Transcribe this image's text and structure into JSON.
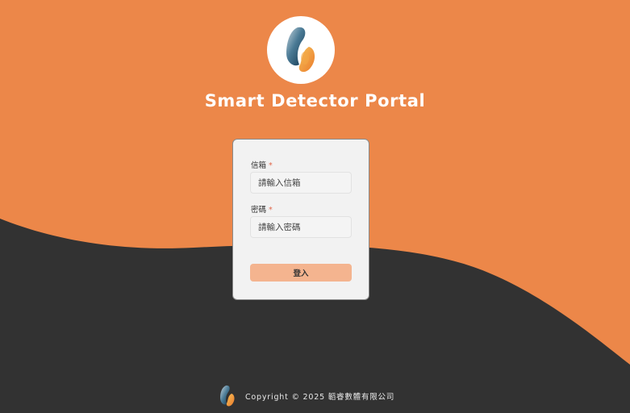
{
  "app": {
    "title": "Smart Detector Portal"
  },
  "login_form": {
    "email": {
      "label": "信箱",
      "required_mark": "*",
      "placeholder": "請輸入信箱"
    },
    "password": {
      "label": "密碼",
      "required_mark": "*",
      "placeholder": "請輸入密碼"
    },
    "submit_label": "登入"
  },
  "footer": {
    "copyright": "Copyright © 2025 韜睿數體有限公司"
  },
  "icons": {
    "logo": "brand-logo-icon",
    "footer_logo": "footer-logo-icon"
  },
  "colors": {
    "background_orange": "#ec8749",
    "background_dark": "#323232",
    "card": "#f2f2f2",
    "button": "#f4b48f",
    "required": "#e0664a"
  }
}
